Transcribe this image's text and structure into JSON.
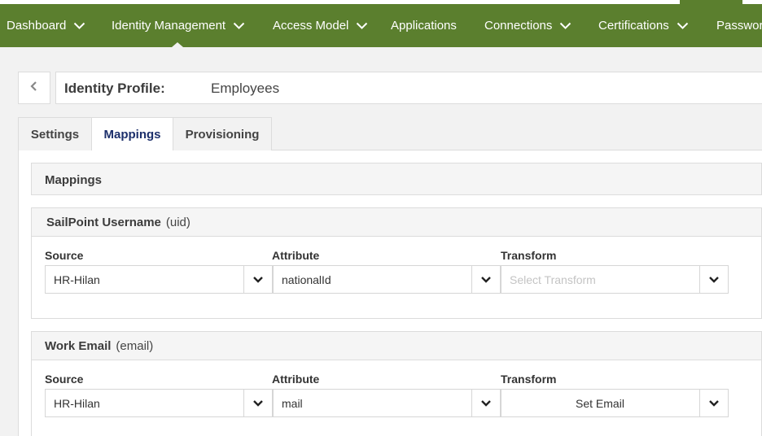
{
  "nav": {
    "items": [
      {
        "label": "Dashboard",
        "has_menu": true
      },
      {
        "label": "Identity Management",
        "has_menu": true,
        "active": true
      },
      {
        "label": "Access Model",
        "has_menu": true
      },
      {
        "label": "Applications",
        "has_menu": false
      },
      {
        "label": "Connections",
        "has_menu": true
      },
      {
        "label": "Certifications",
        "has_menu": true
      },
      {
        "label": "Passwor",
        "has_menu": false
      }
    ],
    "chevron_icon": "chevron-down-icon",
    "color": "#5b7f2e"
  },
  "header": {
    "back_icon": "chevron-left-icon",
    "profile_label": "Identity Profile:",
    "profile_value": "Employees"
  },
  "tabs": [
    {
      "label": "Settings",
      "active": false
    },
    {
      "label": "Mappings",
      "active": true
    },
    {
      "label": "Provisioning",
      "active": false
    }
  ],
  "mappings": {
    "title": "Mappings",
    "sections": [
      {
        "name": "SailPoint Username",
        "key": "(uid)",
        "source_label": "Source",
        "attribute_label": "Attribute",
        "transform_label": "Transform",
        "source_value": "HR-Hilan",
        "attribute_value": "nationalId",
        "transform_value": "",
        "transform_placeholder": "Select Transform"
      },
      {
        "name": "Work Email",
        "key": "(email)",
        "source_label": "Source",
        "attribute_label": "Attribute",
        "transform_label": "Transform",
        "source_value": "HR-Hilan",
        "attribute_value": "mail",
        "transform_value": "Set Email",
        "transform_placeholder": ""
      }
    ]
  }
}
